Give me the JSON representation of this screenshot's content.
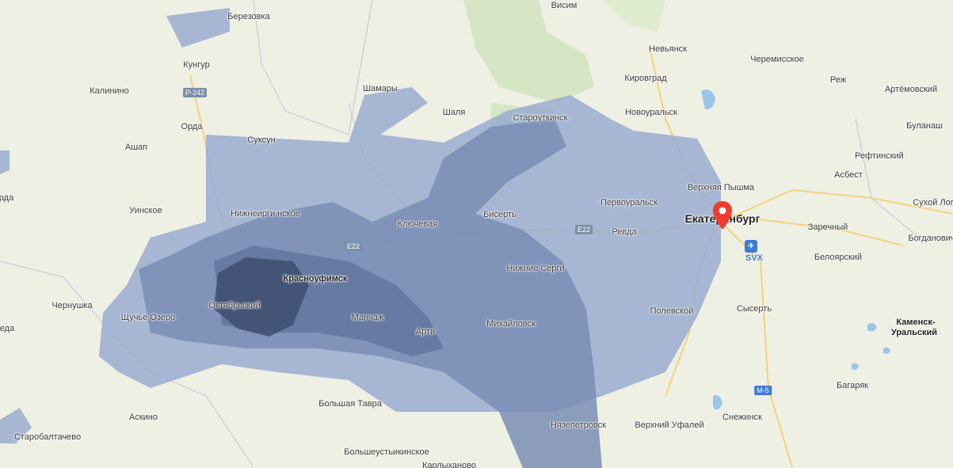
{
  "map": {
    "colors": {
      "land": "#eef0e4",
      "forest": "#d6e6c4",
      "road": "#f5d98a",
      "precip_light": "#9aabcf",
      "precip_mid": "#7a8db4",
      "precip_heavy": "#5d6f97",
      "precip_max": "#3e4e70",
      "water": "#9cc4ea"
    },
    "labels": [
      {
        "text": "Березовка",
        "kind": "town"
      },
      {
        "text": "Висим",
        "kind": "town"
      },
      {
        "text": "Кунгур",
        "kind": "town"
      },
      {
        "text": "Невьянск",
        "kind": "town"
      },
      {
        "text": "Черемисское",
        "kind": "town"
      },
      {
        "text": "Калинино",
        "kind": "town"
      },
      {
        "text": "Кировград",
        "kind": "town"
      },
      {
        "text": "Реж",
        "kind": "town"
      },
      {
        "text": "Артёмовский",
        "kind": "town"
      },
      {
        "text": "Шамары",
        "kind": "town"
      },
      {
        "text": "Шаля",
        "kind": "town"
      },
      {
        "text": "Староуткинск",
        "kind": "town"
      },
      {
        "text": "Новоуральск",
        "kind": "town"
      },
      {
        "text": "Буланаш",
        "kind": "town"
      },
      {
        "text": "Орда",
        "kind": "town"
      },
      {
        "text": "Ашап",
        "kind": "town"
      },
      {
        "text": "Суксун",
        "kind": "town"
      },
      {
        "text": "Рефтинский",
        "kind": "town"
      },
      {
        "text": "Верхняя Пышма",
        "kind": "town"
      },
      {
        "text": "Асбест",
        "kind": "town"
      },
      {
        "text": "Уинское",
        "kind": "town"
      },
      {
        "text": "Нижнеирги нское",
        "kind": "town"
      },
      {
        "text": "Ключевая",
        "kind": "town"
      },
      {
        "text": "Бисерть",
        "kind": "town"
      },
      {
        "text": "Первоуральск",
        "kind": "town"
      },
      {
        "text": "Екатеринбург",
        "kind": "city"
      },
      {
        "text": "Сухой Лог",
        "kind": "town"
      },
      {
        "text": "Заречный",
        "kind": "town"
      },
      {
        "text": "Ревда",
        "kind": "town"
      },
      {
        "text": "Богданович",
        "kind": "town"
      },
      {
        "text": "Белоярский",
        "kind": "town"
      },
      {
        "text": "Красноуфимск",
        "kind": "bold"
      },
      {
        "text": "Нижние Серги",
        "kind": "town"
      },
      {
        "text": "Чернушка",
        "kind": "town"
      },
      {
        "text": "Октябрьский",
        "kind": "town"
      },
      {
        "text": "Полевской",
        "kind": "town"
      },
      {
        "text": "Сысерть",
        "kind": "town"
      },
      {
        "text": "Щучье Озеро",
        "kind": "town"
      },
      {
        "text": "Манчаж",
        "kind": "town"
      },
      {
        "text": "Михайловск",
        "kind": "town"
      },
      {
        "text": "Каменск-",
        "kind": "bold"
      },
      {
        "text": "Уральский",
        "kind": "bold"
      },
      {
        "text": "Арти",
        "kind": "town"
      },
      {
        "text": "Багаряк",
        "kind": "town"
      },
      {
        "text": "Большая Тавра",
        "kind": "town"
      },
      {
        "text": "Аскино",
        "kind": "town"
      },
      {
        "text": "Нязепетровск",
        "kind": "town"
      },
      {
        "text": "Верхний Уфалей",
        "kind": "town"
      },
      {
        "text": "Снежинск",
        "kind": "town"
      },
      {
        "text": "Старобалтачево",
        "kind": "town"
      },
      {
        "text": "Большеустьикинское",
        "kind": "town"
      },
      {
        "text": "Карлыханово",
        "kind": "town"
      },
      {
        "text": "еда",
        "kind": "town"
      },
      {
        "text": "рда",
        "kind": "town"
      }
    ],
    "shields": [
      {
        "text": "P-242",
        "kind": "grey"
      },
      {
        "text": "E22",
        "kind": "grey"
      },
      {
        "text": "E22",
        "kind": "grey"
      },
      {
        "text": "M-5",
        "kind": "blue"
      }
    ],
    "airport_code": "SVX",
    "pin_icon": "location-pin-icon",
    "airport_icon": "airplane-icon"
  }
}
